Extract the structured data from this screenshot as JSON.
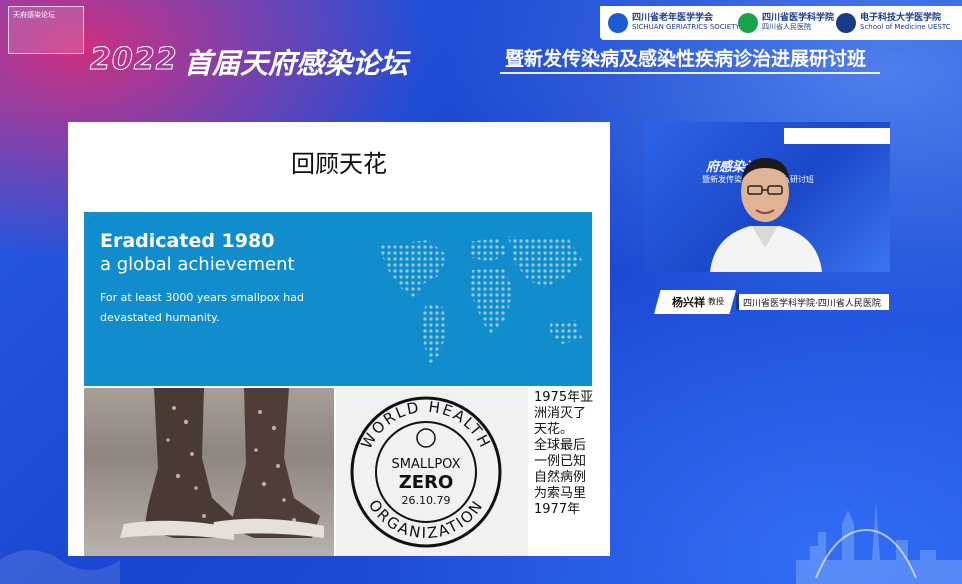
{
  "header": {
    "year": "2022",
    "title": "首届天府感染论坛",
    "subtitle": "暨新发传染病及感染性疾病诊治进展研讨班",
    "logo_left_text": "天府感染论坛",
    "sponsors": [
      {
        "name": "四川省老年医学学会",
        "en": "SICHUAN GERIATRICS SOCIETY",
        "color": "#1d5bd6"
      },
      {
        "name": "四川省医学科学院",
        "en": "四川省人民医院",
        "color": "#19a34a"
      },
      {
        "name": "电子科技大学医学院",
        "en": "School of Medicine UESTC",
        "color": "#1a3a8a"
      }
    ]
  },
  "slide": {
    "title": "回顾天花",
    "banner": {
      "headline": "Eradicated 1980",
      "subheadline": "a global achievement",
      "body": "For at least 3000 years smallpox had devastated humanity."
    },
    "stamp": {
      "top_arc": "WORLD HEALTH",
      "bottom_arc": "ORGANIZATION",
      "line1": "SMALLPOX",
      "line2": "ZERO",
      "date": "26.10.79"
    },
    "side_note_lines": [
      "1975年亚",
      "洲消灭了",
      "天花。",
      "全球最后",
      "一例已知",
      "自然病例",
      "为索马里",
      "1977年"
    ]
  },
  "webcam": {
    "backdrop_title": "府感染论坛",
    "backdrop_subtitle": "暨新发传染病及诊治进展研讨班",
    "speaker_name": "杨兴祥",
    "speaker_title": "教授",
    "speaker_org": "四川省医学科学院·四川省人民医院"
  },
  "colors": {
    "who_blue": "#118ccc",
    "bg_blue": "#1f4fd4",
    "accent_pink": "#eb286e"
  }
}
